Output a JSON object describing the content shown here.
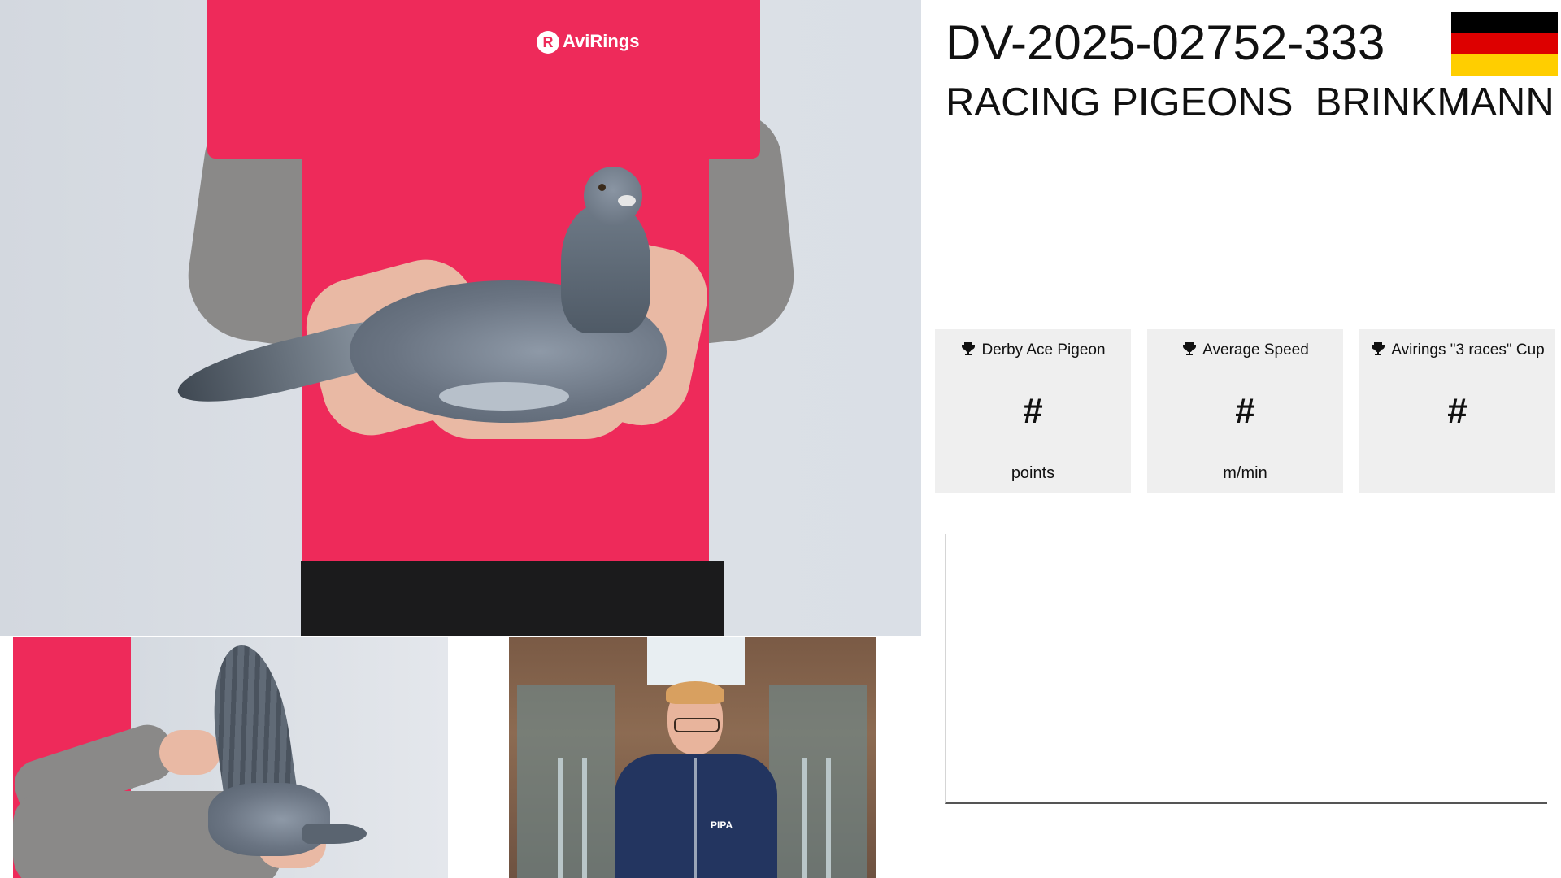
{
  "header": {
    "ring_number": "DV-2025-02752-333",
    "owner": "RACING PIGEONS  BRINKMANN"
  },
  "flag": {
    "country": "Germany",
    "colors": [
      "#000000",
      "#dd0000",
      "#ffce00"
    ]
  },
  "photos": {
    "main": {
      "shirt_logo": "AviRings",
      "subject": "pigeon-held-in-hands"
    },
    "wing": {
      "subject": "pigeon-wing-spread"
    },
    "portrait": {
      "jacket_logo": "PIPA",
      "subject": "breeder-portrait"
    }
  },
  "stats": [
    {
      "title": "Derby Ace Pigeon",
      "value": "#",
      "unit": "points",
      "icon": "trophy-icon"
    },
    {
      "title": "Average Speed",
      "value": "#",
      "unit": "m/min",
      "icon": "trophy-icon"
    },
    {
      "title": "Avirings \"3 races\" Cup",
      "value": "#",
      "unit": "",
      "icon": "trophy-icon"
    }
  ],
  "colors": {
    "card_background": "#efefef",
    "text": "#111111",
    "shirt": "#ee2a5a"
  }
}
